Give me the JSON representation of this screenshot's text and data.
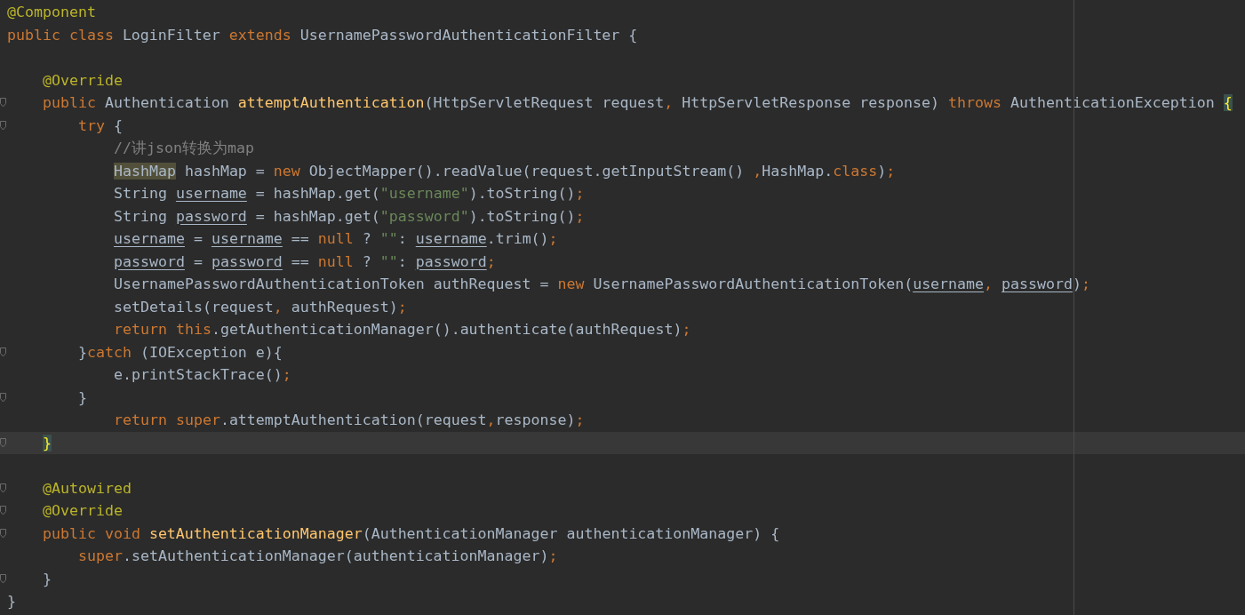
{
  "editor": {
    "lines": [
      {
        "fold": false,
        "current": false,
        "tokens": [
          {
            "kind": "annotation",
            "text": "@Component"
          }
        ]
      },
      {
        "fold": false,
        "current": false,
        "tokens": [
          {
            "kind": "keyword",
            "text": "public class "
          },
          {
            "kind": "plain",
            "text": "LoginFilter "
          },
          {
            "kind": "keyword",
            "text": "extends "
          },
          {
            "kind": "plain",
            "text": "UsernamePasswordAuthenticationFilter {"
          }
        ],
        "children": [
          {
            "fold": false,
            "current": false
          },
          {
            "fold": false,
            "current": false,
            "tokens": [
              {
                "kind": "annotation",
                "text": "@Override"
              }
            ]
          },
          {
            "fold": true,
            "current": false,
            "tokens": [
              {
                "kind": "keyword",
                "text": "public "
              },
              {
                "kind": "plain",
                "text": "Authentication "
              },
              {
                "kind": "method",
                "text": "attemptAuthentication"
              },
              {
                "kind": "plain",
                "text": "(HttpServletRequest request"
              },
              {
                "kind": "keyword",
                "text": ","
              },
              {
                "kind": "plain",
                "text": " HttpServletResponse response) "
              },
              {
                "kind": "keyword",
                "text": "throws "
              },
              {
                "kind": "plain",
                "text": "AuthenticationException "
              },
              {
                "kind": "brace-match",
                "text": "{"
              }
            ],
            "children": [
              {
                "fold": true,
                "current": false,
                "tokens": [
                  {
                    "kind": "keyword",
                    "text": "try "
                  },
                  {
                    "kind": "plain",
                    "text": "{"
                  }
                ],
                "children": [
                  {
                    "fold": false,
                    "current": false,
                    "tokens": [
                      {
                        "kind": "comment",
                        "text": "//讲json转换为map"
                      }
                    ]
                  },
                  {
                    "fold": false,
                    "current": false,
                    "tokens": [
                      {
                        "kind": "usage",
                        "text": "HashMap"
                      },
                      {
                        "kind": "plain",
                        "text": " hashMap = "
                      },
                      {
                        "kind": "keyword",
                        "text": "new "
                      },
                      {
                        "kind": "plain",
                        "text": "ObjectMapper().readValue(request.getInputStream() "
                      },
                      {
                        "kind": "keyword",
                        "text": ","
                      },
                      {
                        "kind": "plain",
                        "text": "HashMap."
                      },
                      {
                        "kind": "keyword",
                        "text": "class"
                      },
                      {
                        "kind": "plain",
                        "text": ")"
                      },
                      {
                        "kind": "keyword",
                        "text": ";"
                      }
                    ]
                  },
                  {
                    "fold": false,
                    "current": false,
                    "tokens": [
                      {
                        "kind": "plain",
                        "text": "String "
                      },
                      {
                        "kind": "variable",
                        "text": "username"
                      },
                      {
                        "kind": "plain",
                        "text": " = hashMap.get("
                      },
                      {
                        "kind": "string",
                        "text": "\"username\""
                      },
                      {
                        "kind": "plain",
                        "text": ").toString()"
                      },
                      {
                        "kind": "keyword",
                        "text": ";"
                      }
                    ]
                  },
                  {
                    "fold": false,
                    "current": false,
                    "tokens": [
                      {
                        "kind": "plain",
                        "text": "String "
                      },
                      {
                        "kind": "variable",
                        "text": "password"
                      },
                      {
                        "kind": "plain",
                        "text": " = hashMap.get("
                      },
                      {
                        "kind": "string",
                        "text": "\"password\""
                      },
                      {
                        "kind": "plain",
                        "text": ").toString()"
                      },
                      {
                        "kind": "keyword",
                        "text": ";"
                      }
                    ]
                  },
                  {
                    "fold": false,
                    "current": false,
                    "tokens": [
                      {
                        "kind": "variable",
                        "text": "username"
                      },
                      {
                        "kind": "plain",
                        "text": " = "
                      },
                      {
                        "kind": "variable",
                        "text": "username"
                      },
                      {
                        "kind": "plain",
                        "text": " == "
                      },
                      {
                        "kind": "keyword",
                        "text": "null "
                      },
                      {
                        "kind": "plain",
                        "text": "? "
                      },
                      {
                        "kind": "string",
                        "text": "\"\""
                      },
                      {
                        "kind": "plain",
                        "text": ": "
                      },
                      {
                        "kind": "variable",
                        "text": "username"
                      },
                      {
                        "kind": "plain",
                        "text": ".trim()"
                      },
                      {
                        "kind": "keyword",
                        "text": ";"
                      }
                    ]
                  },
                  {
                    "fold": false,
                    "current": false,
                    "tokens": [
                      {
                        "kind": "variable",
                        "text": "password"
                      },
                      {
                        "kind": "plain",
                        "text": " = "
                      },
                      {
                        "kind": "variable",
                        "text": "password"
                      },
                      {
                        "kind": "plain",
                        "text": " == "
                      },
                      {
                        "kind": "keyword",
                        "text": "null "
                      },
                      {
                        "kind": "plain",
                        "text": "? "
                      },
                      {
                        "kind": "string",
                        "text": "\"\""
                      },
                      {
                        "kind": "plain",
                        "text": ": "
                      },
                      {
                        "kind": "variable",
                        "text": "password"
                      },
                      {
                        "kind": "keyword",
                        "text": ";"
                      }
                    ]
                  },
                  {
                    "fold": false,
                    "current": false,
                    "tokens": [
                      {
                        "kind": "plain",
                        "text": "UsernamePasswordAuthenticationToken authRequest = "
                      },
                      {
                        "kind": "keyword",
                        "text": "new "
                      },
                      {
                        "kind": "plain",
                        "text": "UsernamePasswordAuthenticationToken("
                      },
                      {
                        "kind": "variable",
                        "text": "username"
                      },
                      {
                        "kind": "keyword",
                        "text": ", "
                      },
                      {
                        "kind": "variable",
                        "text": "password"
                      },
                      {
                        "kind": "plain",
                        "text": ")"
                      },
                      {
                        "kind": "keyword",
                        "text": ";"
                      }
                    ]
                  },
                  {
                    "fold": false,
                    "current": false,
                    "tokens": [
                      {
                        "kind": "plain",
                        "text": "setDetails(request"
                      },
                      {
                        "kind": "keyword",
                        "text": ","
                      },
                      {
                        "kind": "plain",
                        "text": " authRequest)"
                      },
                      {
                        "kind": "keyword",
                        "text": ";"
                      }
                    ]
                  },
                  {
                    "fold": false,
                    "current": false,
                    "tokens": [
                      {
                        "kind": "keyword",
                        "text": "return this"
                      },
                      {
                        "kind": "plain",
                        "text": ".getAuthenticationManager().authenticate(authRequest)"
                      },
                      {
                        "kind": "keyword",
                        "text": ";"
                      }
                    ]
                  }
                ]
              },
              {
                "fold": true,
                "current": false,
                "tokens": [
                  {
                    "kind": "plain",
                    "text": "}"
                  },
                  {
                    "kind": "keyword",
                    "text": "catch "
                  },
                  {
                    "kind": "plain",
                    "text": "(IOException e){"
                  }
                ],
                "children": [
                  {
                    "fold": false,
                    "current": false,
                    "tokens": [
                      {
                        "kind": "plain",
                        "text": "e.printStackTrace()"
                      },
                      {
                        "kind": "keyword",
                        "text": ";"
                      }
                    ]
                  }
                ]
              },
              {
                "fold": true,
                "current": false,
                "tokens": [
                  {
                    "kind": "plain",
                    "text": "}"
                  }
                ],
                "children": [
                  {
                    "fold": false,
                    "current": false,
                    "tokens": [
                      {
                        "kind": "keyword",
                        "text": "return super"
                      },
                      {
                        "kind": "plain",
                        "text": ".attemptAuthentication(request"
                      },
                      {
                        "kind": "keyword",
                        "text": ","
                      },
                      {
                        "kind": "plain",
                        "text": "response)"
                      },
                      {
                        "kind": "keyword",
                        "text": ";"
                      }
                    ]
                  }
                ]
              }
            ]
          },
          {
            "fold": true,
            "current": true,
            "tokens": [
              {
                "kind": "brace-match",
                "text": "}"
              }
            ]
          },
          {
            "fold": false,
            "current": false
          },
          {
            "fold": true,
            "current": false,
            "tokens": [
              {
                "kind": "annotation",
                "text": "@Autowired"
              }
            ]
          },
          {
            "fold": true,
            "current": false,
            "tokens": [
              {
                "kind": "annotation",
                "text": "@Override"
              }
            ]
          },
          {
            "fold": true,
            "current": false,
            "tokens": [
              {
                "kind": "keyword",
                "text": "public void "
              },
              {
                "kind": "method",
                "text": "setAuthenticationManager"
              },
              {
                "kind": "plain",
                "text": "(AuthenticationManager authenticationManager) {"
              }
            ],
            "children": [
              {
                "fold": false,
                "current": false,
                "tokens": [
                  {
                    "kind": "keyword",
                    "text": "super"
                  },
                  {
                    "kind": "plain",
                    "text": ".setAuthenticationManager(authenticationManager)"
                  },
                  {
                    "kind": "keyword",
                    "text": ";"
                  }
                ]
              }
            ]
          },
          {
            "fold": true,
            "current": false,
            "tokens": [
              {
                "kind": "plain",
                "text": "}"
              }
            ]
          }
        ]
      },
      {
        "fold": false,
        "current": false,
        "tokens": [
          {
            "kind": "plain",
            "text": "}"
          }
        ]
      }
    ]
  }
}
